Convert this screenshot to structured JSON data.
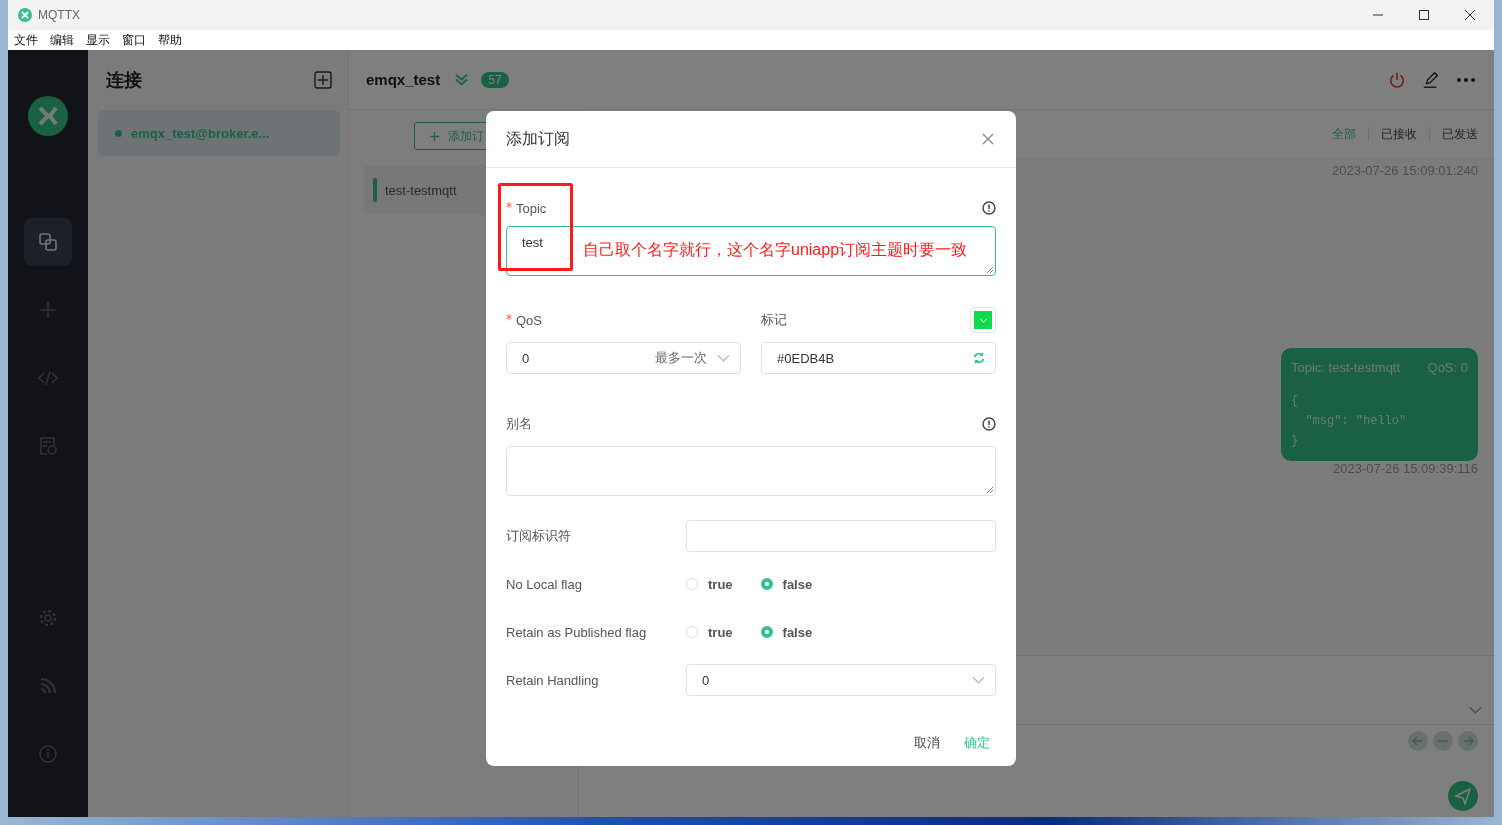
{
  "window": {
    "title": "MQTTX"
  },
  "menu": [
    "文件",
    "编辑",
    "显示",
    "窗口",
    "帮助"
  ],
  "sidebar": [
    {
      "kind": "connections",
      "selected": true
    },
    {
      "kind": "new",
      "selected": false
    },
    {
      "kind": "script",
      "selected": false
    },
    {
      "kind": "log",
      "selected": false
    },
    {
      "kind": "settings",
      "selected": false
    },
    {
      "kind": "feed",
      "selected": false
    },
    {
      "kind": "about",
      "selected": false
    }
  ],
  "connections": {
    "title": "连接",
    "items": [
      {
        "name": "emqx_test@broker.e...",
        "selected": true,
        "connected": true
      }
    ]
  },
  "connection_header": {
    "name": "emqx_test",
    "count": "57"
  },
  "subscriptions": {
    "add_button": "添加订",
    "items": [
      {
        "topic": "test-testmqtt"
      }
    ]
  },
  "message_filters": [
    {
      "label": "全部",
      "selected": true
    },
    {
      "label": "已接收",
      "selected": false
    },
    {
      "label": "已发送",
      "selected": false
    }
  ],
  "messages": [
    {
      "kind": "time",
      "time": "2023-07-26 15:09:01:240"
    },
    {
      "kind": "sent",
      "topic": "Topic: test-testmqtt",
      "qos": "QoS: 0",
      "payload": [
        "{",
        "  \"msg\": \"hello\"",
        "}"
      ],
      "time": "2023-07-26 15:09:39:116"
    }
  ],
  "dialog": {
    "title": "添加订阅",
    "topic": {
      "label": "Topic",
      "required": true,
      "value": "test"
    },
    "qos": {
      "label": "QoS",
      "required": true,
      "value": "0",
      "description": "最多一次"
    },
    "mark": {
      "label": "标记",
      "value": "#0EDB4B",
      "color": "#0edb4b"
    },
    "alias": {
      "label": "别名"
    },
    "subscription_id": {
      "label": "订阅标识符"
    },
    "flags": [
      {
        "label": "No Local flag",
        "options": [
          {
            "label": "true",
            "selected": false
          },
          {
            "label": "false",
            "selected": true
          }
        ]
      },
      {
        "label": "Retain as Published flag",
        "options": [
          {
            "label": "true",
            "selected": false
          },
          {
            "label": "false",
            "selected": true
          }
        ]
      }
    ],
    "retain_handling": {
      "label": "Retain Handling",
      "value": "0"
    },
    "cancel": "取消",
    "confirm": "确定"
  },
  "annotation": {
    "text": "自己取个名字就行，这个名字uniapp订阅主题时要一致"
  }
}
